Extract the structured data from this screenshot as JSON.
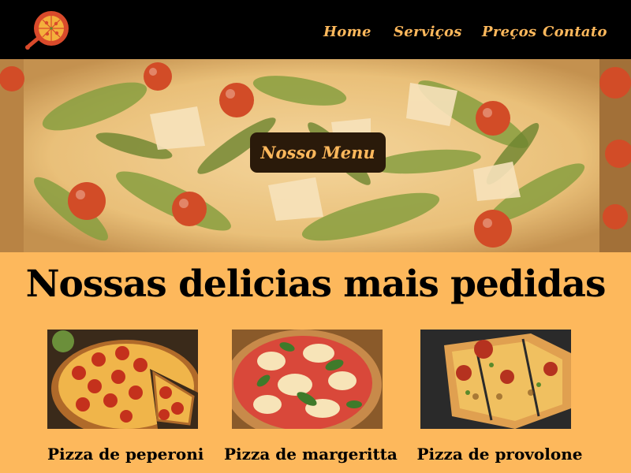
{
  "nav": {
    "links": [
      "Home",
      "Serviços",
      "Preços",
      "Contato"
    ]
  },
  "hero": {
    "button_label": "Nosso Menu"
  },
  "section": {
    "title": "Nossas delicias mais pedidas"
  },
  "cards": [
    {
      "label": "Pizza de peperoni"
    },
    {
      "label": "Pizza de margeritta"
    },
    {
      "label": "Pizza de provolone"
    }
  ],
  "colors": {
    "accent": "#fdb85c",
    "nav_bg": "#000000",
    "button_bg": "#2a1a0a",
    "logo_red": "#d94a2b"
  }
}
